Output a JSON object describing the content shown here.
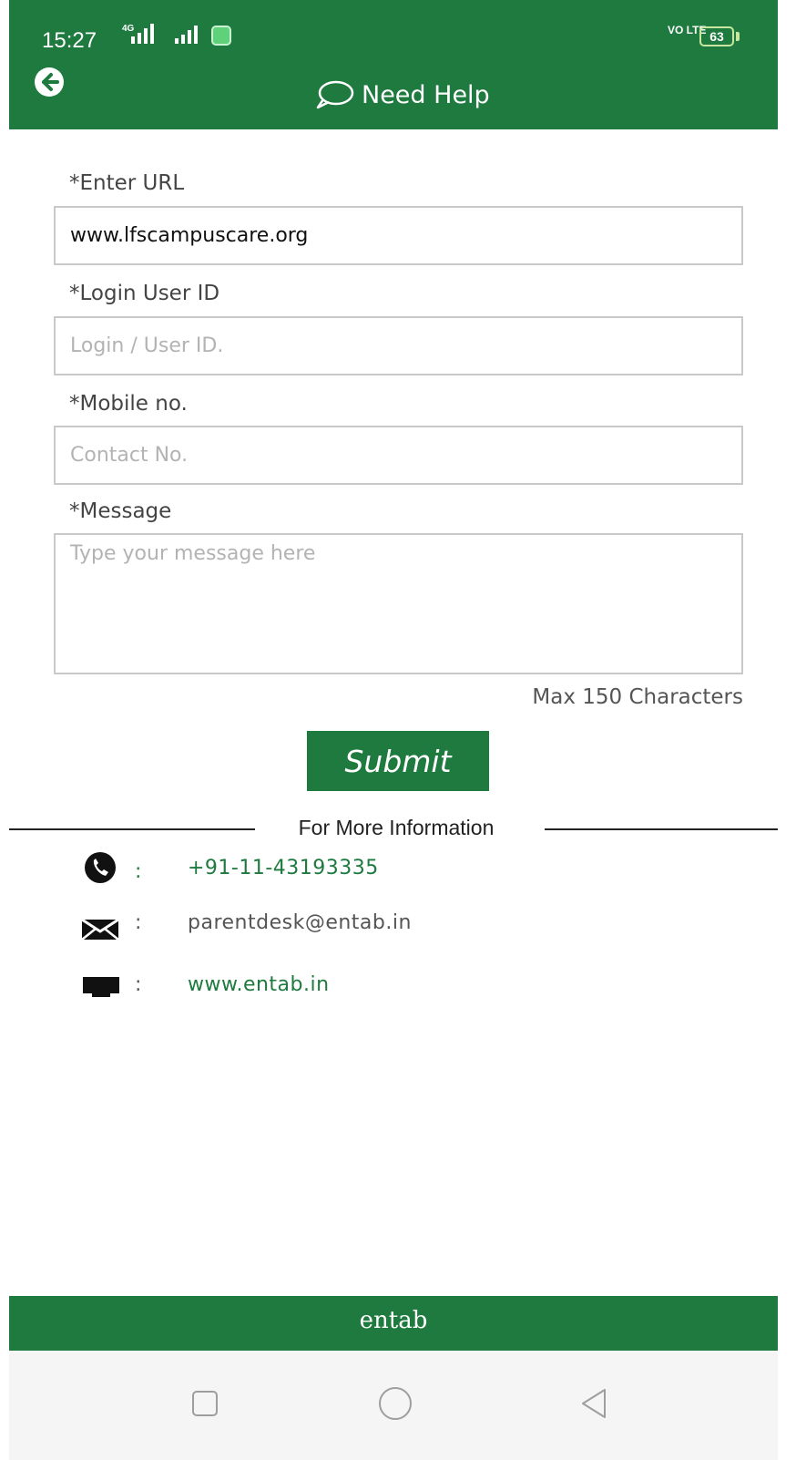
{
  "status_bar": {
    "time": "15:27",
    "network": "4G",
    "volte": "VO LTE",
    "battery": "63"
  },
  "app_bar": {
    "back_icon": "arrow-left-circle-icon",
    "title_icon": "chat-bubble-icon",
    "title": "Need Help"
  },
  "form": {
    "url": {
      "label": "*Enter URL",
      "value": "www.lfscampuscare.org",
      "placeholder": ""
    },
    "login": {
      "label": "*Login User ID",
      "value": "",
      "placeholder": "Login / User ID."
    },
    "mobile": {
      "label": "*Mobile no.",
      "value": "",
      "placeholder": "Contact No."
    },
    "message": {
      "label": "*Message",
      "value": "",
      "placeholder": "Type your message here"
    },
    "max_chars": "Max 150 Characters",
    "submit_label": "Submit"
  },
  "info": {
    "title": "For More Information",
    "separator": ":",
    "phone": "+91-11-43193335",
    "email": "parentdesk@entab.in",
    "website": "www.entab.in"
  },
  "footer": {
    "logo_text": "entab"
  },
  "nav": {
    "icons": [
      "recent-apps-icon",
      "home-icon",
      "back-icon"
    ]
  },
  "colors": {
    "primary": "#1e7a3e",
    "link_green": "#1e7a3e",
    "text_gray": "#555555",
    "border": "#c9c9c9"
  }
}
